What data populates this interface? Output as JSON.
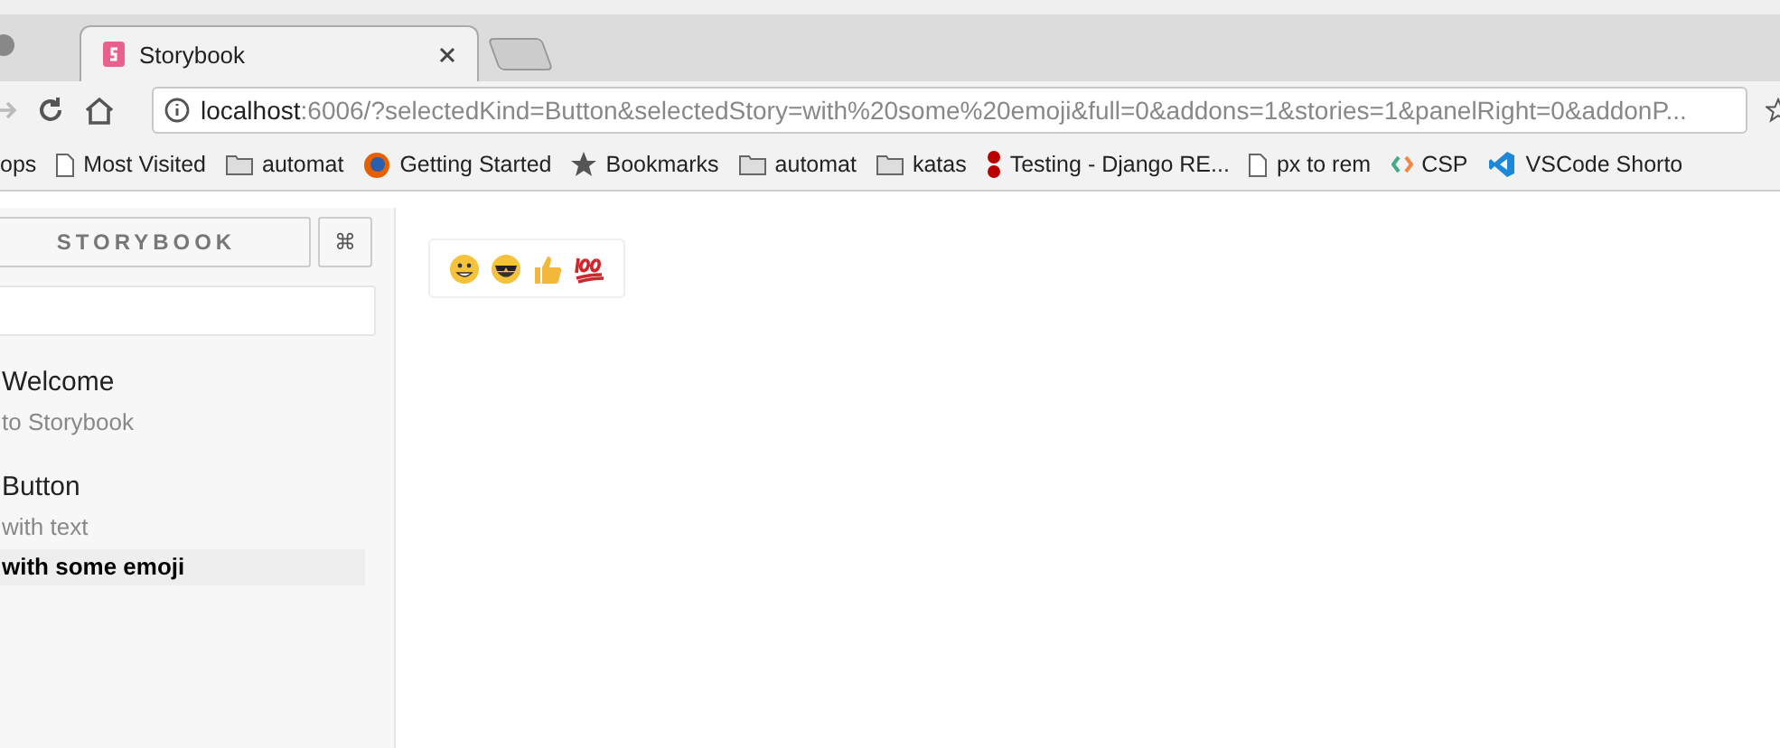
{
  "browser": {
    "tabs": [
      {
        "title": "Storybook",
        "selected": true
      }
    ],
    "url_host": "localhost",
    "url_rest": ":6006/?selectedKind=Button&selectedStory=with%20some%20emoji&full=0&addons=1&stories=1&panelRight=0&addonP...",
    "bookmarks": [
      {
        "label": "ops",
        "kind": "apps"
      },
      {
        "label": "Most Visited",
        "kind": "page"
      },
      {
        "label": "automat",
        "kind": "folder"
      },
      {
        "label": "Getting Started",
        "kind": "firefox"
      },
      {
        "label": "Bookmarks",
        "kind": "star"
      },
      {
        "label": "automat",
        "kind": "folder"
      },
      {
        "label": "katas",
        "kind": "folder"
      },
      {
        "label": "Testing - Django RE...",
        "kind": "django"
      },
      {
        "label": "px to rem",
        "kind": "page"
      },
      {
        "label": "CSP",
        "kind": "csp"
      },
      {
        "label": "VSCode Shorto",
        "kind": "vscode"
      }
    ]
  },
  "sidebar": {
    "title": "STORYBOOK",
    "shortcut": "⌘",
    "kinds": [
      {
        "name": "Welcome",
        "stories": [
          {
            "name": "to Storybook",
            "selected": false
          }
        ]
      },
      {
        "name": "Button",
        "stories": [
          {
            "name": "with text",
            "selected": false
          },
          {
            "name": "with some emoji",
            "selected": true
          }
        ]
      }
    ]
  },
  "preview": {
    "button": {
      "kind": "emoji"
    }
  }
}
